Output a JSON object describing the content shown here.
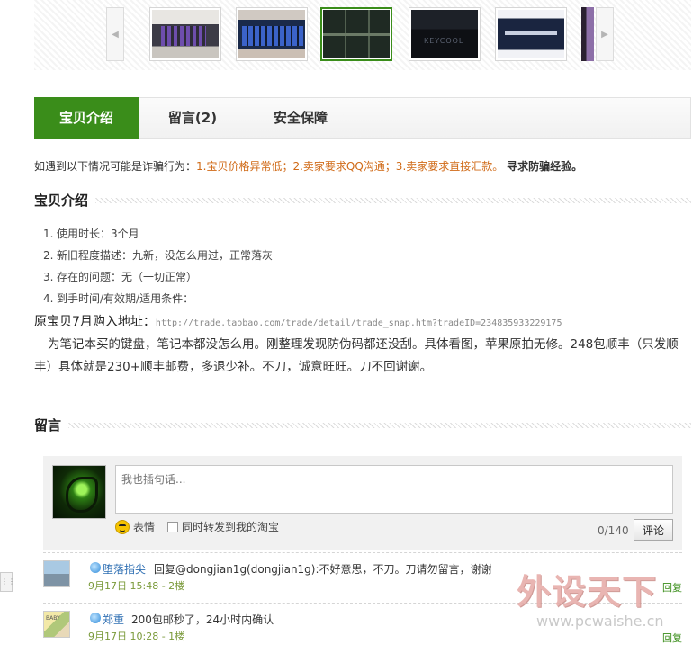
{
  "thumbnails": {
    "prev_icon": "chevron-left-icon",
    "next_icon": "chevron-right-icon",
    "active_index": 2,
    "count": 6
  },
  "tabs": [
    {
      "label": "宝贝介绍",
      "active": true
    },
    {
      "label": "留言(2)",
      "active": false
    },
    {
      "label": "安全保障",
      "active": false
    }
  ],
  "warning": {
    "prefix": "如遇到以下情况可能是诈骗行为：",
    "items": "1.宝贝价格异常低；2.卖家要求QQ沟通；3.卖家要求直接汇款。",
    "link": "寻求防骗经验。"
  },
  "intro": {
    "title": "宝贝介绍",
    "list": [
      {
        "num": "1.",
        "text": "使用时长：3个月"
      },
      {
        "num": "2.",
        "text": "新旧程度描述：九新，没怎么用过，正常落灰"
      },
      {
        "num": "3.",
        "text": "存在的问题：无（一切正常）"
      },
      {
        "num": "4.",
        "text": "到手时间/有效期/适用条件："
      }
    ],
    "orig_label": "原宝贝7月购入地址：",
    "orig_url": "http://trade.taobao.com/trade/detail/trade_snap.htm?tradeID=234835933229175",
    "body": "为笔记本买的键盘，笔记本都没怎么用。刚整理发现防伪码都还没刮。具体看图，苹果原拍无修。248包顺丰（只发顺丰）具体就是230+顺丰邮费，多退少补。不刀，诚意旺旺。刀不回谢谢。"
  },
  "comments_section": {
    "title": "留言",
    "input_placeholder": "我也插句话...",
    "emoji_label": "表情",
    "forward_label": "同时转发到我的淘宝",
    "counter": "0/140",
    "submit_label": "评论",
    "items": [
      {
        "author": "堕落指尖",
        "text": "回复@dongjian1g(dongjian1g):不好意思，不刀。刀请勿留言，谢谢",
        "meta": "9月17日 15:48 - 2楼",
        "reply_label": "回复"
      },
      {
        "author": "郑重",
        "text": "200包邮秒了，24小时内确认",
        "meta": "9月17日 10:28 - 1楼",
        "reply_label": "回复"
      }
    ]
  },
  "watermark": {
    "title": "外设天下",
    "url": "www.pcwaishe.cn"
  },
  "colors": {
    "accent_green": "#3a8d1a",
    "warning_orange": "#d06a17",
    "author_blue": "#2f6fb3"
  }
}
